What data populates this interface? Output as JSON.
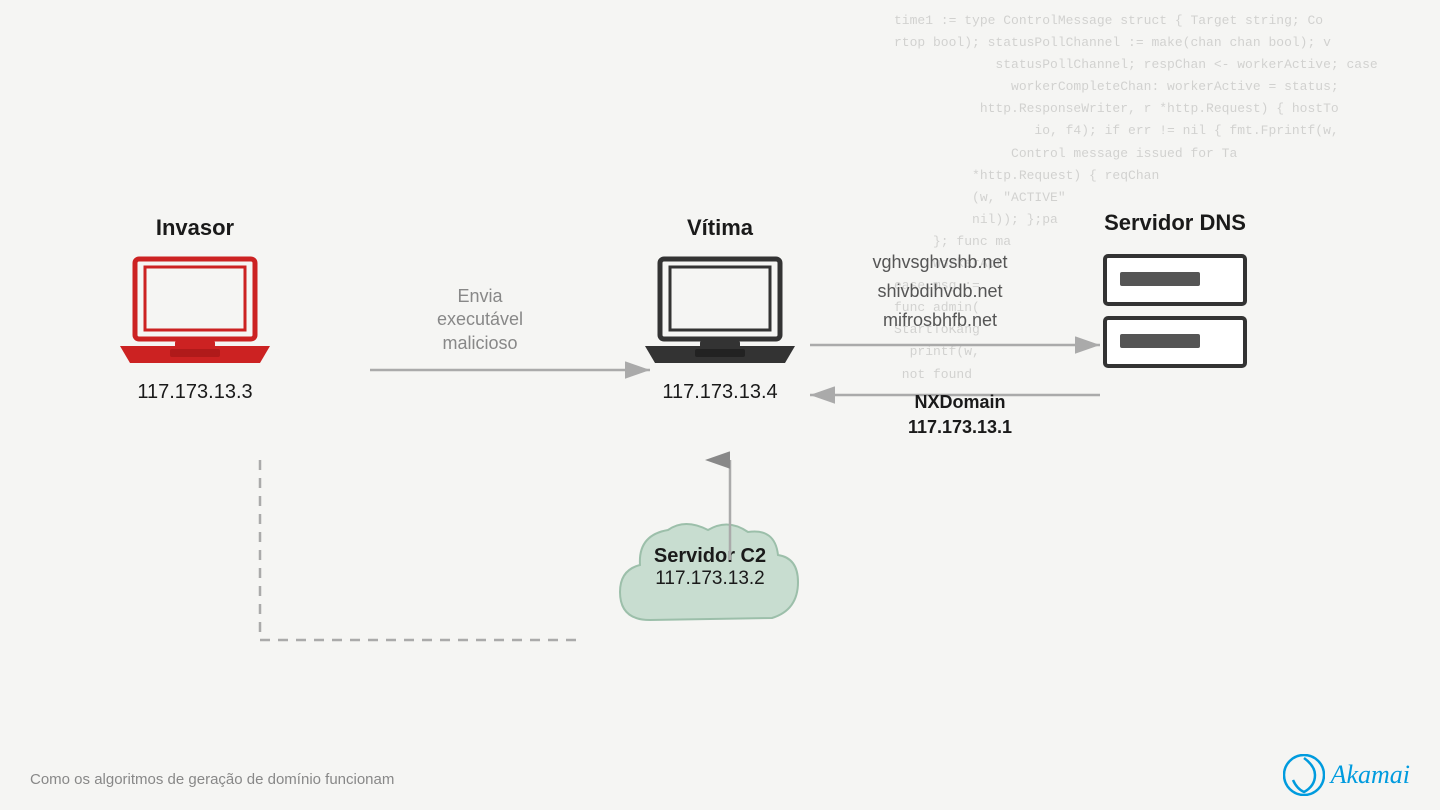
{
  "code_bg": "time1 := type ControlMessage struct { Target string; Co\nrtop bool); statusPollChannel := make(chan chan bool); v\n             statusPollChannel; respChan <- workerActive; case\n               workerCompleteChan: workerActive = status;\n           http.ResponseWriter, r *http.Request) { hostTo\n                  io, f4); if err != nil { fmt.Fprintf(w,\n               Control message issued for Ta\n          *http.Request) { reqChan\n          (w, \"ACTIVE\"\n          nil)); };pa\n     }; func ma\n     workerApt\nease.msg :=\nfunc admin(\nStartToKang\n  printf(w,\n not found",
  "nodes": {
    "invasor": {
      "label": "Invasor",
      "ip": "117.173.13.3"
    },
    "vitima": {
      "label": "Vítima",
      "ip": "117.173.13.4"
    },
    "dns": {
      "label": "Servidor DNS"
    },
    "c2": {
      "label": "Servidor C2",
      "ip": "117.173.13.2"
    }
  },
  "arrow_labels": {
    "send": "Envia\nexecutável\nmalicioso",
    "dns_query_domains": "vghvsghvshb.net\nshivbdihvdb.net\nmifrosbhfb.net",
    "nxdomain": "NXDomain\n117.173.13.1"
  },
  "caption": "Como os algoritmos de geração de domínio funcionam",
  "akamai_text": "Akamai"
}
